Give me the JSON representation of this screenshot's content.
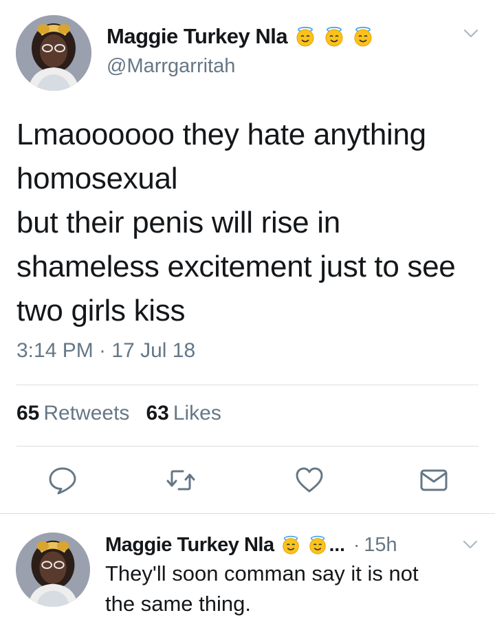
{
  "tweet": {
    "author": {
      "display_name": "Maggie Turkey Nla",
      "handle": "@Marrgarritah",
      "name_emojis": [
        "smiling-face-with-halo",
        "smiling-face-with-halo",
        "smiling-face-with-halo"
      ],
      "avatar": "profile-photo"
    },
    "text": "Lmaoooooo they hate anything homosexual\nbut their penis will rise in shameless excitement just to see two girls kiss",
    "timestamp": "3:14 PM · 17 Jul 18",
    "stats": {
      "retweets_count": "65",
      "retweets_label": "Retweets",
      "likes_count": "63",
      "likes_label": "Likes"
    },
    "actions": [
      {
        "name": "reply",
        "icon": "speech-bubble-icon"
      },
      {
        "name": "retweet",
        "icon": "retweet-arrows-icon"
      },
      {
        "name": "like",
        "icon": "heart-icon"
      },
      {
        "name": "share",
        "icon": "envelope-icon"
      }
    ],
    "menu_icon": "chevron-down-icon"
  },
  "reply": {
    "author": {
      "display_name": "Maggie Turkey Nla",
      "name_emojis": [
        "smiling-face-with-halo",
        "smiling-face-with-halo"
      ],
      "truncation": "...",
      "avatar": "profile-photo"
    },
    "separator": "·",
    "time": "15h",
    "text": "They'll soon comman say it is not\nthe same thing.",
    "menu_icon": "chevron-down-icon"
  },
  "colors": {
    "text_primary": "#14171a",
    "text_secondary": "#657786",
    "icon_gray": "#657786",
    "divider": "#d9dee3",
    "emoji_yellow": "#fcc21b"
  }
}
